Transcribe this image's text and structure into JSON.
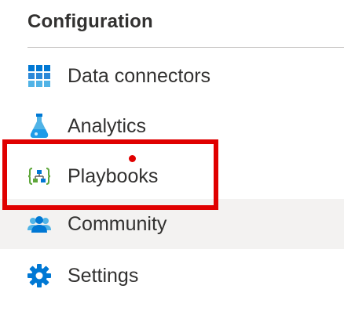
{
  "section": {
    "title": "Configuration"
  },
  "nav": {
    "items": [
      {
        "label": "Data connectors",
        "icon": "grid-icon"
      },
      {
        "label": "Analytics",
        "icon": "flask-icon"
      },
      {
        "label": "Playbooks",
        "icon": "playbook-icon"
      },
      {
        "label": "Community",
        "icon": "people-icon"
      },
      {
        "label": "Settings",
        "icon": "gear-icon"
      }
    ],
    "hovered": "Community",
    "highlighted": "Playbooks"
  },
  "colors": {
    "icon_blue": "#0078d4",
    "icon_light_blue": "#50b3e6",
    "highlight_red": "#e00000",
    "hover_background": "#f3f2f1",
    "text": "#323130",
    "playbook_green": "#5ea63a"
  }
}
